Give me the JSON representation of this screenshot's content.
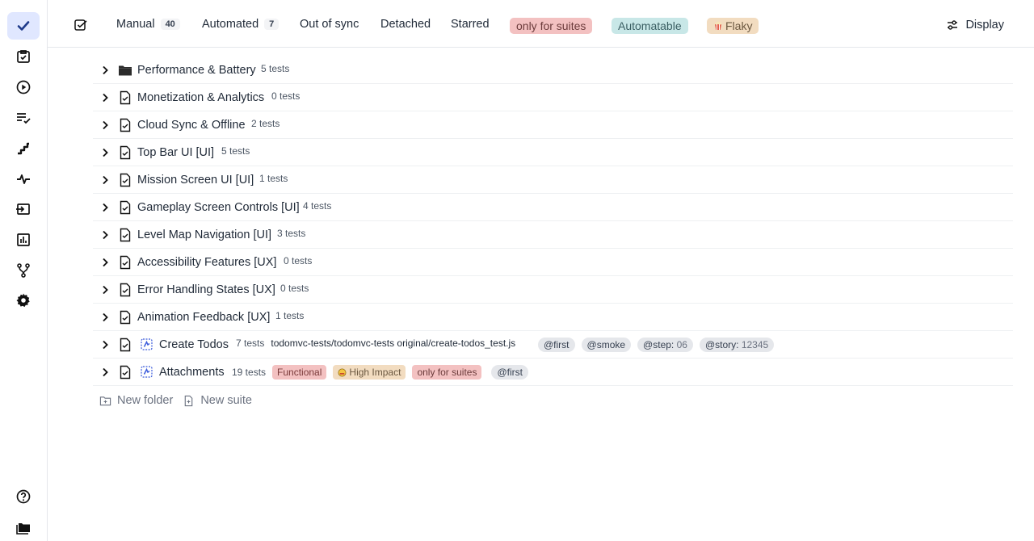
{
  "tabs": [
    {
      "label": "Manual",
      "count": "40"
    },
    {
      "label": "Automated",
      "count": "7"
    },
    {
      "label": "Out of sync"
    },
    {
      "label": "Detached"
    },
    {
      "label": "Starred"
    }
  ],
  "filter_pills": [
    {
      "label": "only for suites",
      "bg": "#f3c1c1",
      "fg": "#6b3b3b"
    },
    {
      "label": "Automatable",
      "bg": "#c8e7e7",
      "fg": "#3b5f63"
    },
    {
      "label": "Flaky",
      "bg": "#f2dcc0",
      "fg": "#6b5840",
      "icon": "popcorn-icon"
    }
  ],
  "display_label": "Display",
  "tree": [
    {
      "title": "Performance & Battery",
      "count": "5 tests",
      "icon": "folder-icon"
    },
    {
      "title": "Monetization & Analytics",
      "count": "0 tests",
      "icon": "suite-icon"
    },
    {
      "title": "Cloud Sync & Offline",
      "count": "2 tests",
      "icon": "suite-icon"
    },
    {
      "title": "Top Bar UI [UI]",
      "count": "5 tests",
      "icon": "suite-icon"
    },
    {
      "title": "Mission Screen UI [UI]",
      "count": "1 tests",
      "icon": "suite-icon"
    },
    {
      "title": "Gameplay Screen Controls [UI]",
      "count": "4 tests",
      "icon": "suite-icon"
    },
    {
      "title": "Level Map Navigation [UI]",
      "count": "3 tests",
      "icon": "suite-icon"
    },
    {
      "title": "Accessibility Features [UX]",
      "count": "0 tests",
      "icon": "suite-icon"
    },
    {
      "title": "Error Handling States [UX]",
      "count": "0 tests",
      "icon": "suite-icon"
    },
    {
      "title": "Animation Feedback [UX]",
      "count": "1 tests",
      "icon": "suite-icon"
    },
    {
      "title": "Create Todos",
      "count": "7 tests",
      "icon": "suite-icon",
      "automated": true,
      "path": "todomvc-tests/todomvc-tests original/create-todos_test.js",
      "tags": [
        {
          "name": "@first"
        },
        {
          "name": "@smoke"
        },
        {
          "name": "@step:",
          "value": "06"
        },
        {
          "name": "@story:",
          "value": "12345"
        }
      ]
    },
    {
      "title": "Attachments",
      "count": "19 tests",
      "icon": "suite-icon",
      "automated": true,
      "labels": [
        {
          "text": "Functional",
          "bg": "#f3c1c1",
          "fg": "#7a3a3a"
        },
        {
          "text": "High Impact",
          "bg": "#f2dcc0",
          "fg": "#6b5840",
          "icon": "face-icon"
        },
        {
          "text": "only for suites",
          "bg": "#f3c1c1",
          "fg": "#6b3b3b"
        }
      ],
      "tags": [
        {
          "name": "@first"
        }
      ]
    }
  ],
  "actions": {
    "new_folder": "New folder",
    "new_suite": "New suite"
  }
}
